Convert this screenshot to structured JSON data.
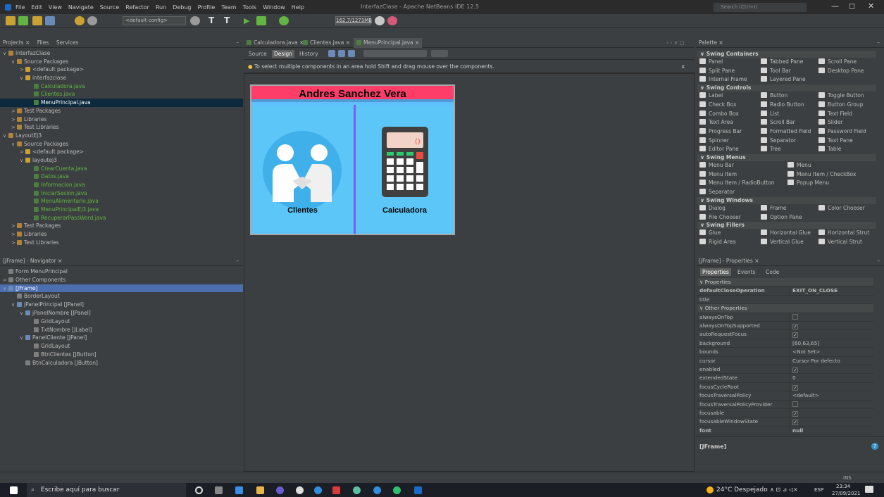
{
  "window": {
    "title": "InterfazClase - Apache NetBeans IDE 12.5",
    "search_placeholder": "Search (Ctrl+I)",
    "minimize": "—",
    "maximize": "◻",
    "close": "✕"
  },
  "menu": [
    "File",
    "Edit",
    "View",
    "Navigate",
    "Source",
    "Refactor",
    "Run",
    "Debug",
    "Profile",
    "Team",
    "Tools",
    "Window",
    "Help"
  ],
  "toolbar": {
    "config": "<default config>",
    "memory": "162,7/1273MB"
  },
  "projects": {
    "tabs": [
      "Projects ×",
      "Files",
      "Services"
    ],
    "items": [
      {
        "label": "InterfazClase",
        "indent": 0,
        "arrow": "∨",
        "icon": "if"
      },
      {
        "label": "Source Packages",
        "indent": 1,
        "arrow": "∨",
        "icon": "if"
      },
      {
        "label": "<default package>",
        "indent": 2,
        "arrow": ">",
        "icon": "ip"
      },
      {
        "label": "interfazclase",
        "indent": 2,
        "arrow": "∨",
        "icon": "ip"
      },
      {
        "label": "Calculadora.java",
        "indent": 3,
        "arrow": "",
        "icon": "ij",
        "green": true
      },
      {
        "label": "Clientes.java",
        "indent": 3,
        "arrow": "",
        "icon": "ij",
        "green": true
      },
      {
        "label": "MenuPrincipal.java",
        "indent": 3,
        "arrow": "",
        "icon": "ij",
        "selected": true
      },
      {
        "label": "Test Packages",
        "indent": 1,
        "arrow": ">",
        "icon": "if"
      },
      {
        "label": "Libraries",
        "indent": 1,
        "arrow": ">",
        "icon": "if"
      },
      {
        "label": "Test Libraries",
        "indent": 1,
        "arrow": ">",
        "icon": "if"
      },
      {
        "label": "LayoutEj3",
        "indent": 0,
        "arrow": "∨",
        "icon": "if"
      },
      {
        "label": "Source Packages",
        "indent": 1,
        "arrow": "∨",
        "icon": "if"
      },
      {
        "label": "<default package>",
        "indent": 2,
        "arrow": ">",
        "icon": "ip"
      },
      {
        "label": "layoutej3",
        "indent": 2,
        "arrow": "∨",
        "icon": "ip"
      },
      {
        "label": "CrearCuenta.java",
        "indent": 3,
        "arrow": "",
        "icon": "ij",
        "green": true
      },
      {
        "label": "Datos.java",
        "indent": 3,
        "arrow": "",
        "icon": "ij",
        "green": true
      },
      {
        "label": "Informacion.java",
        "indent": 3,
        "arrow": "",
        "icon": "ij",
        "green": true
      },
      {
        "label": "IniciarSesion.java",
        "indent": 3,
        "arrow": "",
        "icon": "ij",
        "green": true
      },
      {
        "label": "MenuAlimentario.java",
        "indent": 3,
        "arrow": "",
        "icon": "ij",
        "green": true
      },
      {
        "label": "MenuPrincipalEj3.java",
        "indent": 3,
        "arrow": "",
        "icon": "ij",
        "green": true
      },
      {
        "label": "RecuperarPassWord.java",
        "indent": 3,
        "arrow": "",
        "icon": "ij",
        "green": true
      },
      {
        "label": "Test Packages",
        "indent": 1,
        "arrow": ">",
        "icon": "if"
      },
      {
        "label": "Libraries",
        "indent": 1,
        "arrow": ">",
        "icon": "if"
      },
      {
        "label": "Test Libraries",
        "indent": 1,
        "arrow": ">",
        "icon": "if"
      }
    ]
  },
  "navigator": {
    "title": "[JFrame] - Navigator ×",
    "items": [
      {
        "label": "Form MenuPrincipal",
        "indent": 0,
        "arrow": "",
        "icon": "ig"
      },
      {
        "label": "Other Components",
        "indent": 0,
        "arrow": ">",
        "icon": "ig"
      },
      {
        "label": "[JFrame]",
        "indent": 0,
        "arrow": "∨",
        "icon": "ib",
        "selected": true
      },
      {
        "label": "BorderLayout",
        "indent": 1,
        "arrow": "",
        "icon": "ig"
      },
      {
        "label": "jPanelPrincipal [JPanel]",
        "indent": 1,
        "arrow": "∨",
        "icon": "ib"
      },
      {
        "label": "jPanelNombre [JPanel]",
        "indent": 2,
        "arrow": "∨",
        "icon": "ib"
      },
      {
        "label": "GridLayout",
        "indent": 3,
        "arrow": "",
        "icon": "ig"
      },
      {
        "label": "TxtNombre [JLabel]",
        "indent": 3,
        "arrow": "",
        "icon": "ig"
      },
      {
        "label": "PanelCliente [JPanel]",
        "indent": 2,
        "arrow": "∨",
        "icon": "ib"
      },
      {
        "label": "GridLayout",
        "indent": 3,
        "arrow": "",
        "icon": "ig"
      },
      {
        "label": "BtnClientes [JButton]",
        "indent": 3,
        "arrow": "",
        "icon": "ig"
      },
      {
        "label": "BtnCalculadora [JButton]",
        "indent": 2,
        "arrow": "",
        "icon": "ig"
      }
    ]
  },
  "editor": {
    "tabs": [
      "Calculadora.java ×",
      "Clientes.java ×",
      "MenuPrincipal.java ×"
    ],
    "views": [
      "Source",
      "Design",
      "History"
    ],
    "hint": "To select multiple components in an area hold Shift and drag mouse over the components.",
    "hint_close": "x"
  },
  "form": {
    "title": "Andres Sanchez Vera",
    "btn_clientes": "Clientes",
    "btn_calculadora": "Calculadora"
  },
  "palette": {
    "title": "Palette ×",
    "categories": [
      {
        "name": "∨ Swing Containers",
        "items": [
          "Panel",
          "Tabbed Pane",
          "Scroll Pane",
          "Split Pane",
          "Tool Bar",
          "Desktop Pane",
          "Internal Frame",
          "Layered Pane"
        ]
      },
      {
        "name": "∨ Swing Controls",
        "items": [
          "Label",
          "Button",
          "Toggle Button",
          "Check Box",
          "Radio Button",
          "Button Group",
          "Combo Box",
          "List",
          "Text Field",
          "Text Area",
          "Scroll Bar",
          "Slider",
          "Progress Bar",
          "Formatted Field",
          "Password Field",
          "Spinner",
          "Separator",
          "Text Pane",
          "Editor Pane",
          "Tree",
          "Table"
        ]
      },
      {
        "name": "∨ Swing Menus",
        "items": [
          "Menu Bar",
          "Menu",
          "Menu Item",
          "Menu Item / CheckBox",
          "Menu Item / RadioButton",
          "Popup Menu",
          "Separator"
        ]
      },
      {
        "name": "∨ Swing Windows",
        "items": [
          "Dialog",
          "Frame",
          "Color Chooser",
          "File Chooser",
          "Option Pane"
        ]
      },
      {
        "name": "∨ Swing Fillers",
        "items": [
          "Glue",
          "Horizontal Glue",
          "Horizontal Strut",
          "Rigid Area",
          "Vertical Glue",
          "Vertical Strut"
        ]
      }
    ]
  },
  "properties": {
    "title": "[JFrame] - Properties ×",
    "tabs": [
      "Properties",
      "Events",
      "Code"
    ],
    "rows": [
      {
        "k": "∨ Properties",
        "hdr": true
      },
      {
        "k": "defaultCloseOperation",
        "v": "EXIT_ON_CLOSE",
        "bold": true
      },
      {
        "k": "title",
        "v": ""
      },
      {
        "k": "∨ Other Properties",
        "hdr": true
      },
      {
        "k": "alwaysOnTop",
        "v": "",
        "cb": ""
      },
      {
        "k": "alwaysOnTopSupported",
        "v": "",
        "cb": "✓"
      },
      {
        "k": "autoRequestFocus",
        "v": "",
        "cb": "✓"
      },
      {
        "k": "background",
        "v": "[60,63,65]"
      },
      {
        "k": "bounds",
        "v": "<Not Set>"
      },
      {
        "k": "cursor",
        "v": "Cursor Por defecto"
      },
      {
        "k": "enabled",
        "v": "",
        "cb": "✓"
      },
      {
        "k": "extendedState",
        "v": "0"
      },
      {
        "k": "focusCycleRoot",
        "v": "",
        "cb": "✓"
      },
      {
        "k": "focusTraversalPolicy",
        "v": "<default>"
      },
      {
        "k": "focusTraversalPolicyProvider",
        "v": "",
        "cb": ""
      },
      {
        "k": "focusable",
        "v": "",
        "cb": "✓"
      },
      {
        "k": "focusableWindowState",
        "v": "",
        "cb": "✓"
      },
      {
        "k": "font",
        "v": "null",
        "bold": true
      }
    ],
    "footer": "[JFrame]"
  },
  "status": {
    "ins": "INS"
  },
  "taskbar": {
    "search": "Escribe aquí para buscar",
    "weather": "24°C Despejado",
    "lang": "ESP",
    "time": "23:34",
    "date": "27/09/2021"
  }
}
